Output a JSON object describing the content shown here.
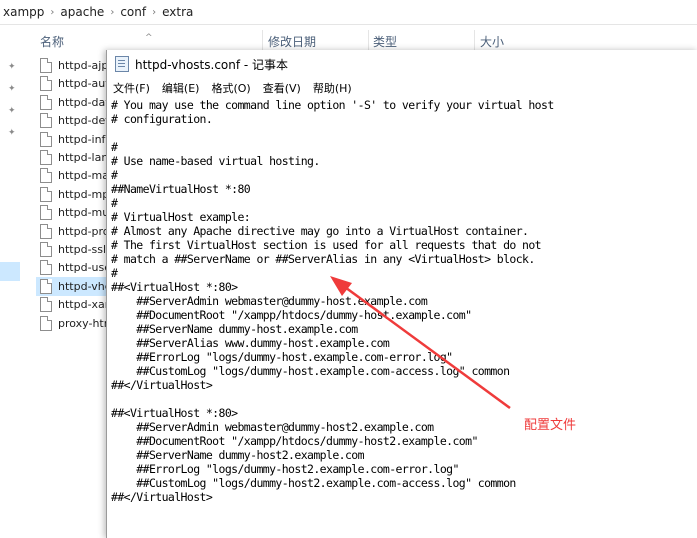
{
  "breadcrumb": {
    "items": [
      "xampp",
      "apache",
      "conf",
      "extra"
    ],
    "separator": "›"
  },
  "columns": {
    "name": "名称",
    "modified": "修改日期",
    "type": "类型",
    "size": "大小"
  },
  "files": [
    "httpd-ajp",
    "httpd-aut",
    "httpd-dav",
    "httpd-def",
    "httpd-info",
    "httpd-lan",
    "httpd-ma",
    "httpd-mp",
    "httpd-mu",
    "httpd-pro",
    "httpd-ssl.",
    "httpd-use",
    "httpd-vhc",
    "httpd-xan",
    "proxy-htr"
  ],
  "selected_file_index": 12,
  "notepad": {
    "title": "httpd-vhosts.conf - 记事本",
    "menu": [
      "文件(F)",
      "编辑(E)",
      "格式(O)",
      "查看(V)",
      "帮助(H)"
    ],
    "lines": [
      "# You may use the command line option '-S' to verify your virtual host",
      "# configuration.",
      "",
      "#",
      "# Use name-based virtual hosting.",
      "#",
      "##NameVirtualHost *:80",
      "#",
      "# VirtualHost example:",
      "# Almost any Apache directive may go into a VirtualHost container.",
      "# The first VirtualHost section is used for all requests that do not",
      "# match a ##ServerName or ##ServerAlias in any <VirtualHost> block.",
      "#",
      "##<VirtualHost *:80>",
      "    ##ServerAdmin webmaster@dummy-host.example.com",
      "    ##DocumentRoot \"/xampp/htdocs/dummy-host.example.com\"",
      "    ##ServerName dummy-host.example.com",
      "    ##ServerAlias www.dummy-host.example.com",
      "    ##ErrorLog \"logs/dummy-host.example.com-error.log\"",
      "    ##CustomLog \"logs/dummy-host.example.com-access.log\" common",
      "##</VirtualHost>",
      "",
      "##<VirtualHost *:80>",
      "    ##ServerAdmin webmaster@dummy-host2.example.com",
      "    ##DocumentRoot \"/xampp/htdocs/dummy-host2.example.com\"",
      "    ##ServerName dummy-host2.example.com",
      "    ##ErrorLog \"logs/dummy-host2.example.com-error.log\"",
      "    ##CustomLog \"logs/dummy-host2.example.com-access.log\" common",
      "##</VirtualHost>"
    ]
  },
  "annotation": {
    "label": "配置文件",
    "color": "#ef3b3b"
  },
  "icons": {
    "pin": "pin-icon",
    "file": "file-icon",
    "notepad": "notepad-icon",
    "sort": "sort-up-icon"
  }
}
